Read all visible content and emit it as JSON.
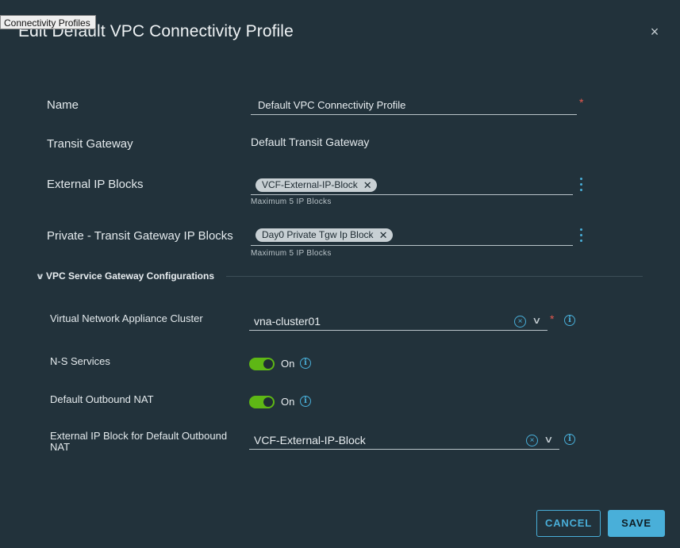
{
  "tooltip": "Connectivity Profiles",
  "dialog": {
    "title": "Edit Default VPC Connectivity Profile",
    "close_label": "×"
  },
  "form": {
    "name": {
      "label": "Name",
      "value": "Default VPC Connectivity Profile",
      "required_mark": "*"
    },
    "transit_gateway": {
      "label": "Transit Gateway",
      "value": "Default Transit Gateway"
    },
    "external_ip_blocks": {
      "label": "External IP Blocks",
      "chip": "VCF-External-IP-Block",
      "hint": "Maximum 5 IP Blocks"
    },
    "private_tgw_blocks": {
      "label": "Private - Transit Gateway IP Blocks",
      "chip": "Day0 Private Tgw Ip Block",
      "hint": "Maximum 5 IP Blocks"
    }
  },
  "section": {
    "title": "VPC Service Gateway Configurations",
    "chevron": "∨",
    "vna_cluster": {
      "label": "Virtual Network Appliance Cluster",
      "value": "vna-cluster01",
      "required_mark": "*"
    },
    "ns_services": {
      "label": "N-S Services",
      "state": "On",
      "on": true
    },
    "default_outbound_nat": {
      "label": "Default Outbound NAT",
      "state": "On",
      "on": true
    },
    "ext_ip_block_nat": {
      "label_line1": "External IP Block for Default Outbound",
      "label_line2": "NAT",
      "value": "VCF-External-IP-Block"
    }
  },
  "icons": {
    "clear": "×",
    "chevron": "∨",
    "info": "i",
    "chip_remove": "✕"
  },
  "buttons": {
    "cancel": "CANCEL",
    "save": "SAVE"
  },
  "colors": {
    "accent": "#49afd9",
    "toggle_on": "#5eb715",
    "required": "#e5584e",
    "background": "#22323b"
  }
}
